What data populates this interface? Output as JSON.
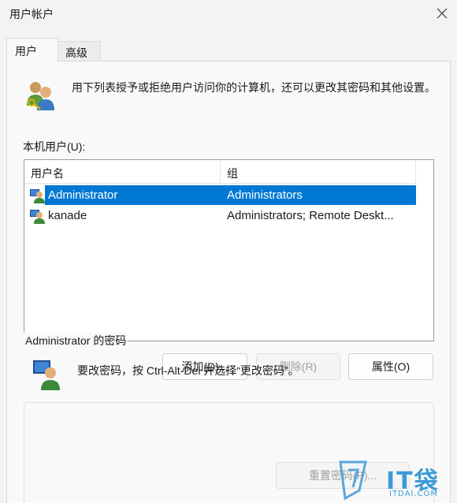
{
  "window": {
    "title": "用户帐户",
    "close_icon": "close-icon"
  },
  "tabs": [
    {
      "label": "用户",
      "active": true
    },
    {
      "label": "高级",
      "active": false
    }
  ],
  "intro": {
    "icon": "users-icon",
    "text": "用下列表授予或拒绝用户访问你的计算机，还可以更改其密码和其他设置。"
  },
  "users_list": {
    "label": "本机用户(U):",
    "columns": [
      "用户名",
      "组"
    ],
    "rows": [
      {
        "name": "Administrator",
        "group": "Administrators",
        "selected": true,
        "icon": "user-icon"
      },
      {
        "name": "kanade",
        "group": "Administrators; Remote Deskt...",
        "selected": false,
        "icon": "user-icon"
      }
    ]
  },
  "buttons": {
    "add": "添加(D)...",
    "remove": "删除(R)",
    "properties": "属性(O)"
  },
  "password_group": {
    "title": "Administrator 的密码",
    "icon": "user-monitor-icon",
    "text": "要改密码，按 Ctrl-Alt-Del 并选择“更改密码”。",
    "reset_button": "重置密码(P)..."
  },
  "watermark": {
    "big": "IT袋",
    "small": "ITDAI.COM"
  },
  "colors": {
    "selection": "#0078d4",
    "watermark": "#3c9ad8"
  }
}
